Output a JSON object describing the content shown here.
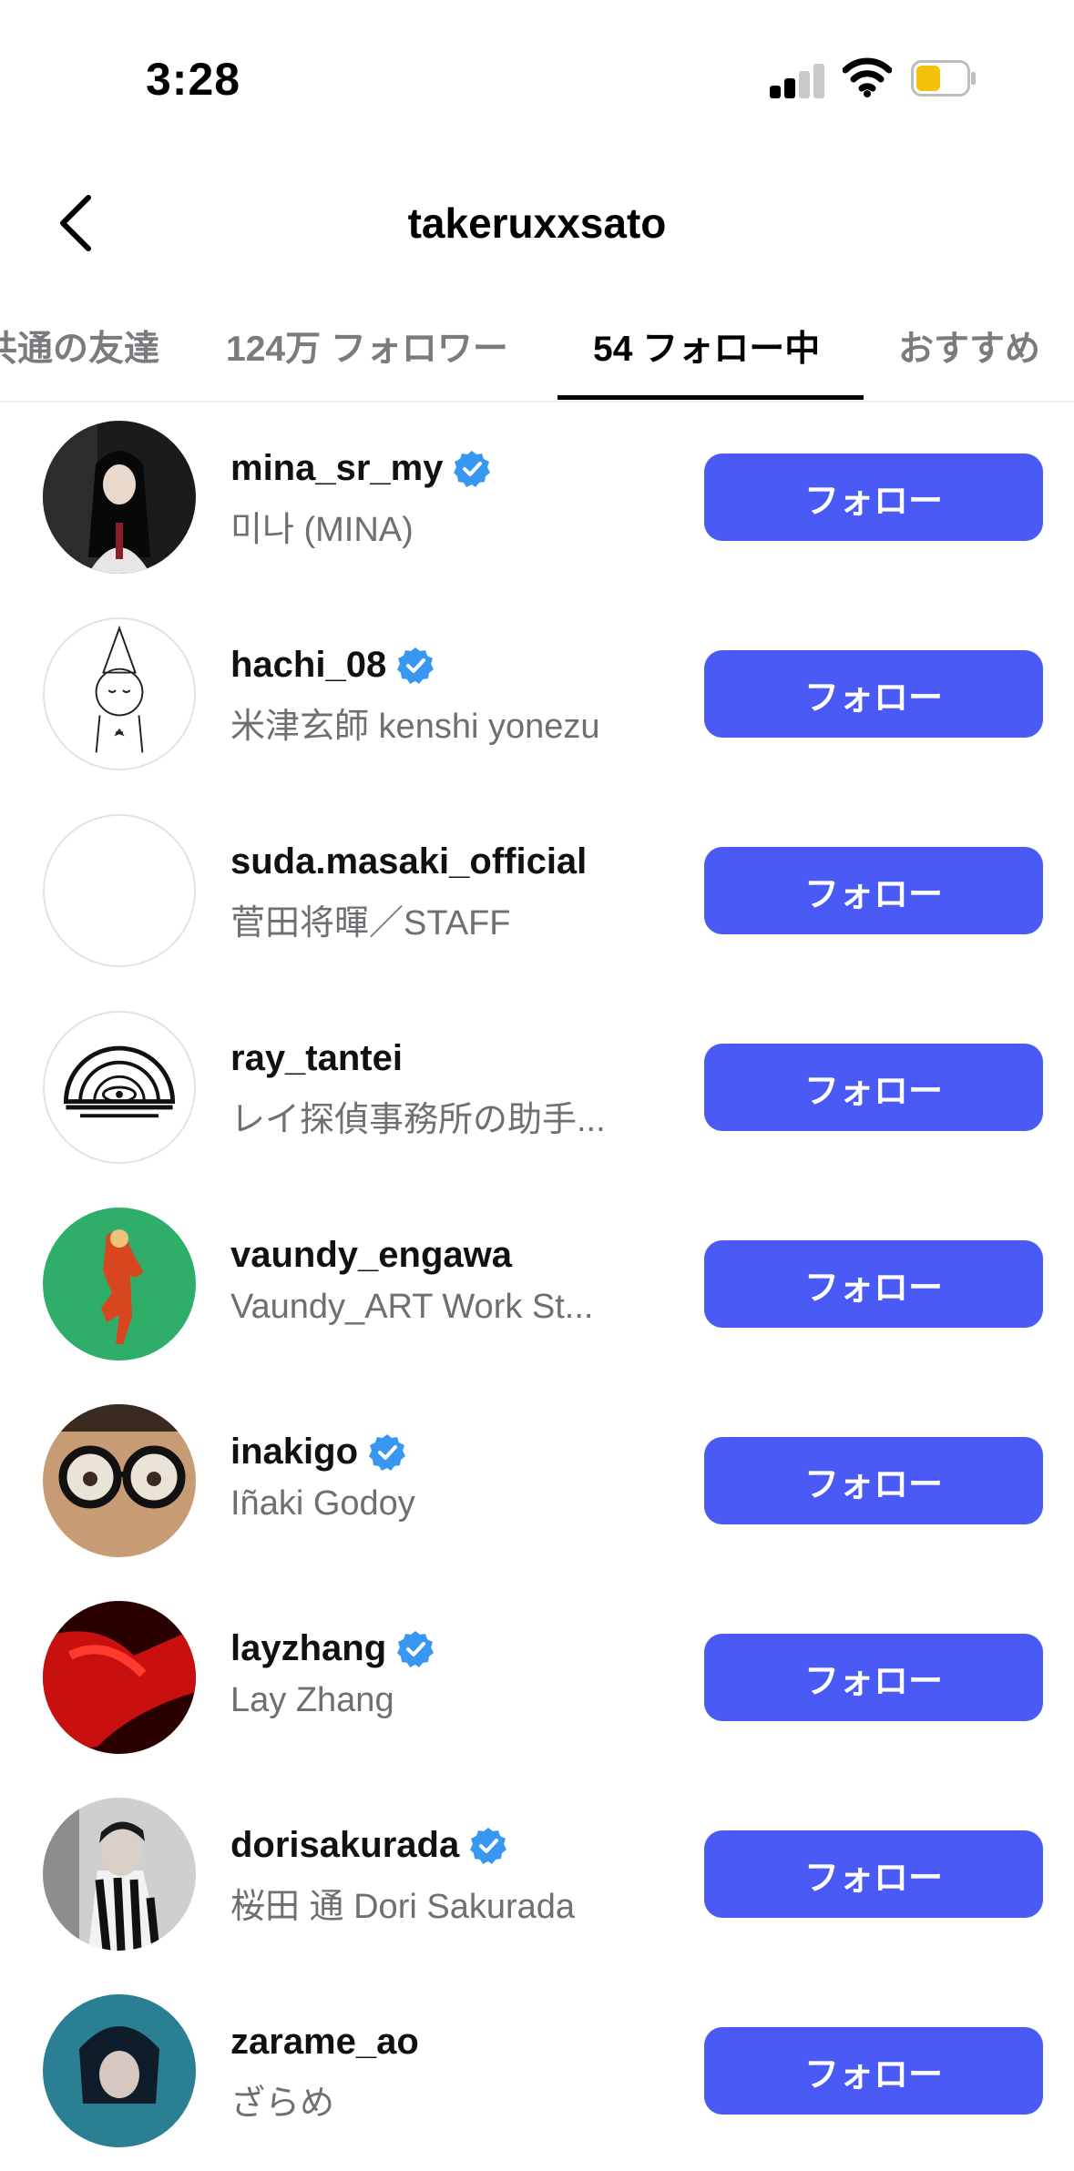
{
  "status": {
    "time": "3:28"
  },
  "header": {
    "title": "takeruxxsato"
  },
  "tabs": [
    {
      "label": "共通の友達"
    },
    {
      "label": "124万 フォロワー"
    },
    {
      "label": "54 フォロー中"
    },
    {
      "label": "おすすめ"
    }
  ],
  "follow_label": "フォロー",
  "accounts": [
    {
      "username": "mina_sr_my",
      "name": "미나 (MINA)",
      "verified": true
    },
    {
      "username": "hachi_08",
      "name": "米津玄師 kenshi yonezu",
      "verified": true
    },
    {
      "username": "suda.masaki_official",
      "name": "菅田将暉／STAFF",
      "verified": false
    },
    {
      "username": "ray_tantei",
      "name": "レイ探偵事務所の助手...",
      "verified": false
    },
    {
      "username": "vaundy_engawa",
      "name": "Vaundy_ART Work St...",
      "verified": false
    },
    {
      "username": "inakigo",
      "name": "Iñaki Godoy",
      "verified": true
    },
    {
      "username": "layzhang",
      "name": "Lay Zhang",
      "verified": true
    },
    {
      "username": "dorisakurada",
      "name": "桜田 通 Dori Sakurada",
      "verified": true
    },
    {
      "username": "zarame_ao",
      "name": "ざらめ",
      "verified": false
    }
  ],
  "colors": {
    "button": "#4a5bf5",
    "verified": "#3897f0"
  }
}
